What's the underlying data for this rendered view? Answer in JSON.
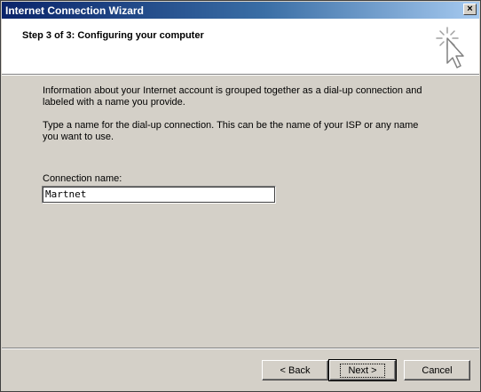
{
  "window": {
    "title": "Internet Connection Wizard",
    "close_glyph": "×"
  },
  "header": {
    "step_title": "Step 3 of 3: Configuring your computer"
  },
  "content": {
    "paragraph1": "Information about your Internet account is grouped together as a dial-up connection and labeled with a name you provide.",
    "paragraph2": "Type a name for the dial-up connection. This can be the name of your ISP or any name you want to use.",
    "connection_label": "Connection name:",
    "connection_value": "Martnet"
  },
  "buttons": {
    "back": "< Back",
    "next": "Next >",
    "cancel": "Cancel"
  },
  "icons": {
    "header": "wizard-cursor-sparkle-icon",
    "close": "close-icon"
  }
}
